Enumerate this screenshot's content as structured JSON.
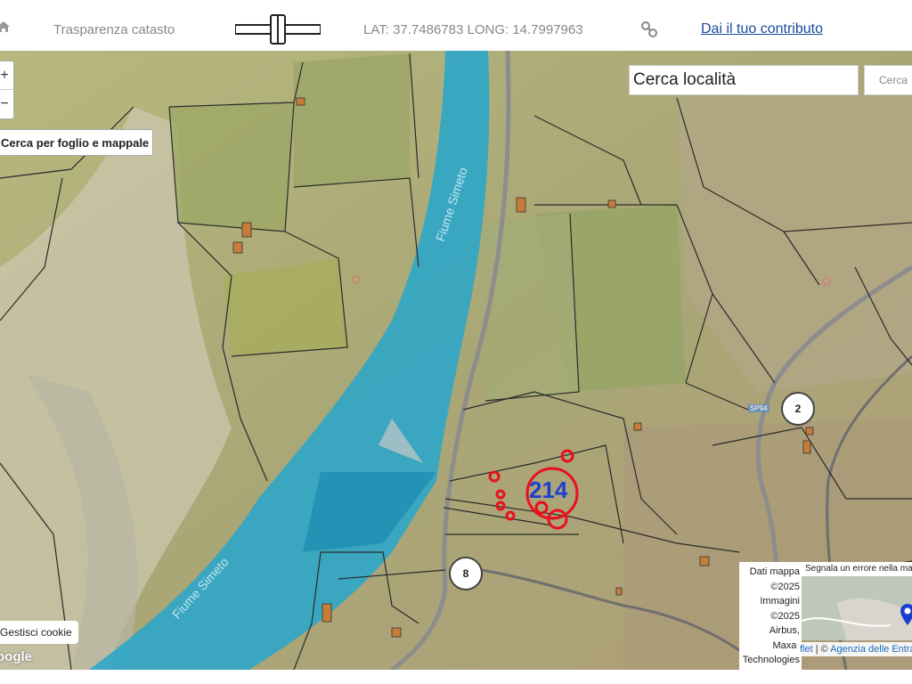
{
  "toolbar": {
    "home_icon": "home-icon",
    "transparency_label": "Trasparenza catasto",
    "coords": "LAT: 37.7486783 LONG: 14.7997963",
    "link_icon": "link-icon",
    "contribute_label": "Dai il tuo contributo"
  },
  "map": {
    "zoom_in": "+",
    "zoom_out": "−",
    "search_parcel_button": "Cerca per foglio e mappale",
    "search_placeholder": "Cerca località",
    "search_button": "Cerca",
    "parcel_number": "214",
    "river_label_upper": "Fiume Simeto",
    "river_label_lower": "Fiume Simeto",
    "road_marker_a": "2",
    "road_marker_b": "8",
    "road_tag": "SP94",
    "cookie_button": "Gestisci cookie",
    "google_logo": "oogle",
    "attribution_lines": [
      "Dati mappa",
      "©2025",
      "Immagini",
      "©2025",
      "Airbus,",
      "Maxar",
      "Technologies"
    ],
    "report_error": "Segnala un errore nella mappa",
    "leaflet_prefix": "flet",
    "leaflet_sep": " | © ",
    "leaflet_agency": "Agenzia delle Entrate",
    "pin_icon": "map-pin-icon"
  },
  "colors": {
    "river": "#2aa6c9",
    "parcel_lines": "#2a2a2a",
    "highlight": "#e8101c",
    "parcel_label": "#1f3fd0",
    "link": "#1a4a9a"
  }
}
